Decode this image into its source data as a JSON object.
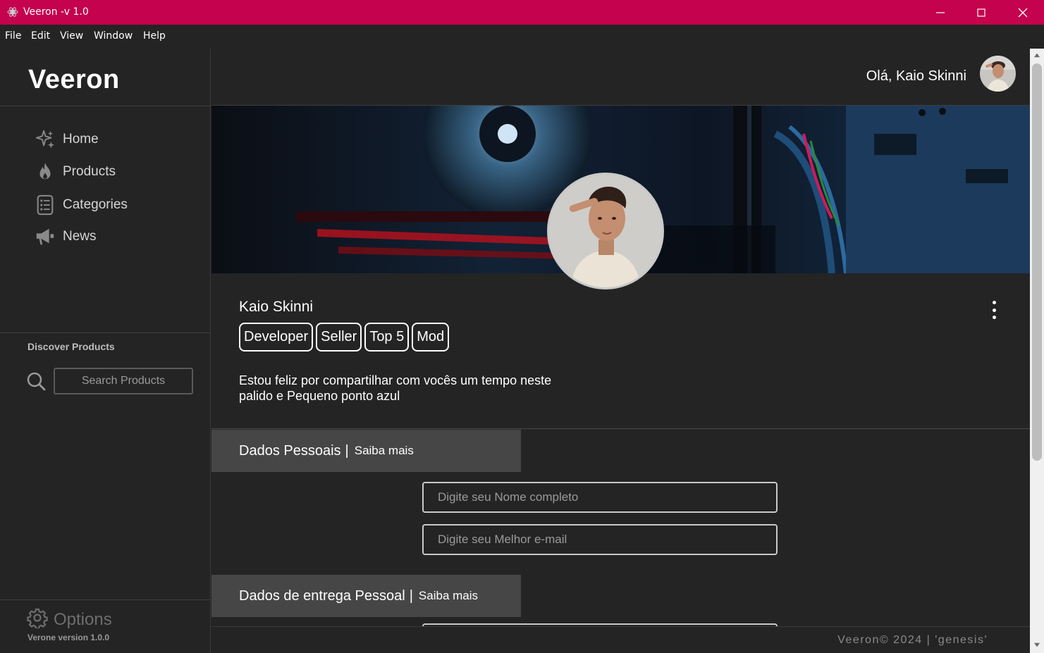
{
  "window": {
    "title": "Veeron -v 1.0",
    "accent_color": "#c4024e",
    "app_icon": "electron-icon",
    "controls": [
      "minimize-icon",
      "maximize-icon",
      "close-icon"
    ]
  },
  "menu": [
    "File",
    "Edit",
    "View",
    "Window",
    "Help"
  ],
  "sidebar": {
    "brand": "Veeron",
    "nav": [
      {
        "label": "Home",
        "icon": "sparkle-icon"
      },
      {
        "label": "Products",
        "icon": "flame-icon"
      },
      {
        "label": "Categories",
        "icon": "list-icon"
      },
      {
        "label": "News",
        "icon": "megaphone-icon"
      }
    ],
    "discover_label": "Discover Products",
    "search_placeholder": "Search Products",
    "options_label": "Options",
    "version": "Verone version 1.0.0"
  },
  "header": {
    "greeting": "Olá, Kaio Skinni"
  },
  "profile": {
    "name": "Kaio Skinni",
    "badges": [
      "Developer",
      "Seller",
      "Top 5",
      "Mod"
    ],
    "bio_line1": "Estou feliz por compartilhar com vocês um tempo neste",
    "bio_line2": "palido e Pequeno ponto azul"
  },
  "sections": [
    {
      "title": "Dados Pessoais",
      "separator": "|",
      "link": "Saiba mais",
      "fields": [
        {
          "placeholder": "Digite seu Nome completo",
          "value": ""
        },
        {
          "placeholder": "Digite seu Melhor e-mail",
          "value": ""
        }
      ]
    },
    {
      "title": "Dados de entrega Pessoal",
      "separator": "|",
      "link": "Saiba mais",
      "fields": []
    }
  ],
  "footer": {
    "text": "Veeron© 2024 | 'genesis'"
  }
}
